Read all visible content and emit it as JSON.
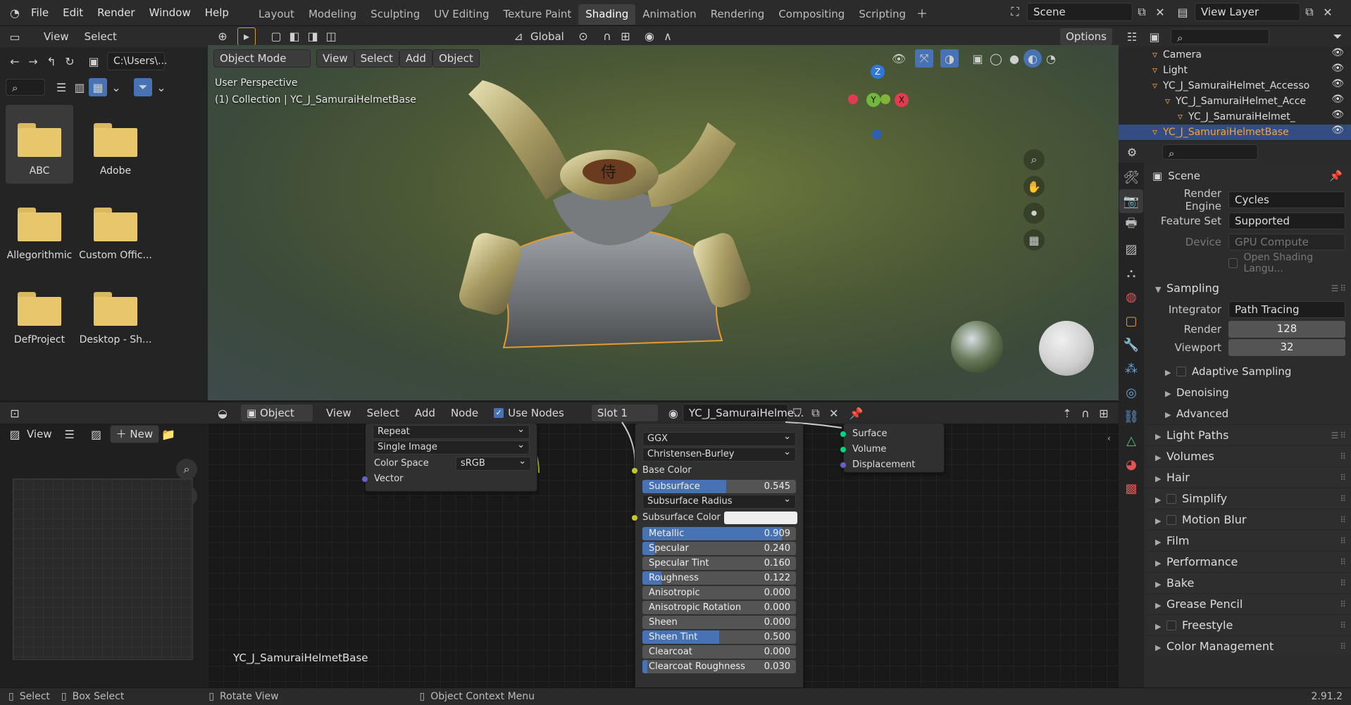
{
  "menu": [
    "File",
    "Edit",
    "Render",
    "Window",
    "Help"
  ],
  "workspaces": [
    "Layout",
    "Modeling",
    "Sculpting",
    "UV Editing",
    "Texture Paint",
    "Shading",
    "Animation",
    "Rendering",
    "Compositing",
    "Scripting"
  ],
  "active_workspace": "Shading",
  "scene": "Scene",
  "view_layer": "View Layer",
  "filebrowser": {
    "view": "View",
    "select": "Select",
    "path": "C:\\Users\\...",
    "items": [
      "ABC",
      "Adobe",
      "Allegorithmic",
      "Custom Offic...",
      "DefProject",
      "Desktop - Sh..."
    ]
  },
  "viewport": {
    "transform": "Global",
    "options": "Options",
    "mode": "Object Mode",
    "menus": [
      "View",
      "Select",
      "Add",
      "Object"
    ],
    "perspective": "User Perspective",
    "collection": "(1) Collection | YC_J_SamuraiHelmetBase",
    "axes": {
      "z": "Z",
      "y": "Y",
      "x": "X"
    }
  },
  "image_editor": {
    "view": "View",
    "new": "New"
  },
  "node_editor": {
    "type": "Object",
    "menus": [
      "View",
      "Select",
      "Add",
      "Node"
    ],
    "use_nodes": "Use Nodes",
    "slot": "Slot 1",
    "material": "YC_J_SamuraiHelme...",
    "object_label": "YC_J_SamuraiHelmetBase",
    "image_node": {
      "extension": "Repeat",
      "source": "Single Image",
      "color_space_label": "Color Space",
      "color_space": "sRGB",
      "vector": "Vector"
    },
    "bsdf": {
      "distribution": "GGX",
      "subsurface_method": "Christensen-Burley",
      "base_color": "Base Color",
      "subsurface_radius": "Subsurface Radius",
      "subsurface_color": "Subsurface Color",
      "sliders": [
        {
          "label": "Subsurface",
          "value": "0.545",
          "fraction": 0.545
        },
        {
          "label": "Metallic",
          "value": "0.909",
          "fraction": 0.909
        },
        {
          "label": "Specular",
          "value": "0.240",
          "fraction": 0.08
        },
        {
          "label": "Specular Tint",
          "value": "0.160",
          "fraction": 0.0
        },
        {
          "label": "Roughness",
          "value": "0.122",
          "fraction": 0.122
        },
        {
          "label": "Anisotropic",
          "value": "0.000",
          "fraction": 0.0
        },
        {
          "label": "Anisotropic Rotation",
          "value": "0.000",
          "fraction": 0.0
        },
        {
          "label": "Sheen",
          "value": "0.000",
          "fraction": 0.0
        },
        {
          "label": "Sheen Tint",
          "value": "0.500",
          "fraction": 0.5
        },
        {
          "label": "Clearcoat",
          "value": "0.000",
          "fraction": 0.0
        },
        {
          "label": "Clearcoat Roughness",
          "value": "0.030",
          "fraction": 0.03
        }
      ]
    },
    "output": [
      "Surface",
      "Volume",
      "Displacement"
    ]
  },
  "outliner": {
    "items": [
      {
        "label": "Camera",
        "indent": 1
      },
      {
        "label": "Light",
        "indent": 1
      },
      {
        "label": "YC_J_SamuraiHelmet_Accesso",
        "indent": 1
      },
      {
        "label": "YC_J_SamuraiHelmet_Acce",
        "indent": 2
      },
      {
        "label": "YC_J_SamuraiHelmet_",
        "indent": 3
      },
      {
        "label": "YC_J_SamuraiHelmetBase",
        "indent": 1
      }
    ]
  },
  "properties": {
    "scene": "Scene",
    "render_engine_label": "Render Engine",
    "render_engine": "Cycles",
    "feature_set_label": "Feature Set",
    "feature_set": "Supported",
    "device_label": "Device",
    "device": "GPU Compute",
    "osl": "Open Shading Langu...",
    "sampling": "Sampling",
    "integrator_label": "Integrator",
    "integrator": "Path Tracing",
    "render_label": "Render",
    "render": "128",
    "viewport_label": "Viewport",
    "viewport": "32",
    "subsections": [
      "Adaptive Sampling",
      "Denoising",
      "Advanced"
    ],
    "sections": [
      "Light Paths",
      "Volumes",
      "Hair",
      "Simplify",
      "Motion Blur",
      "Film",
      "Performance",
      "Bake",
      "Grease Pencil",
      "Freestyle",
      "Color Management"
    ]
  },
  "status": {
    "select": "Select",
    "box_select": "Box Select",
    "rotate": "Rotate View",
    "context": "Object Context Menu",
    "version": "2.91.2"
  }
}
